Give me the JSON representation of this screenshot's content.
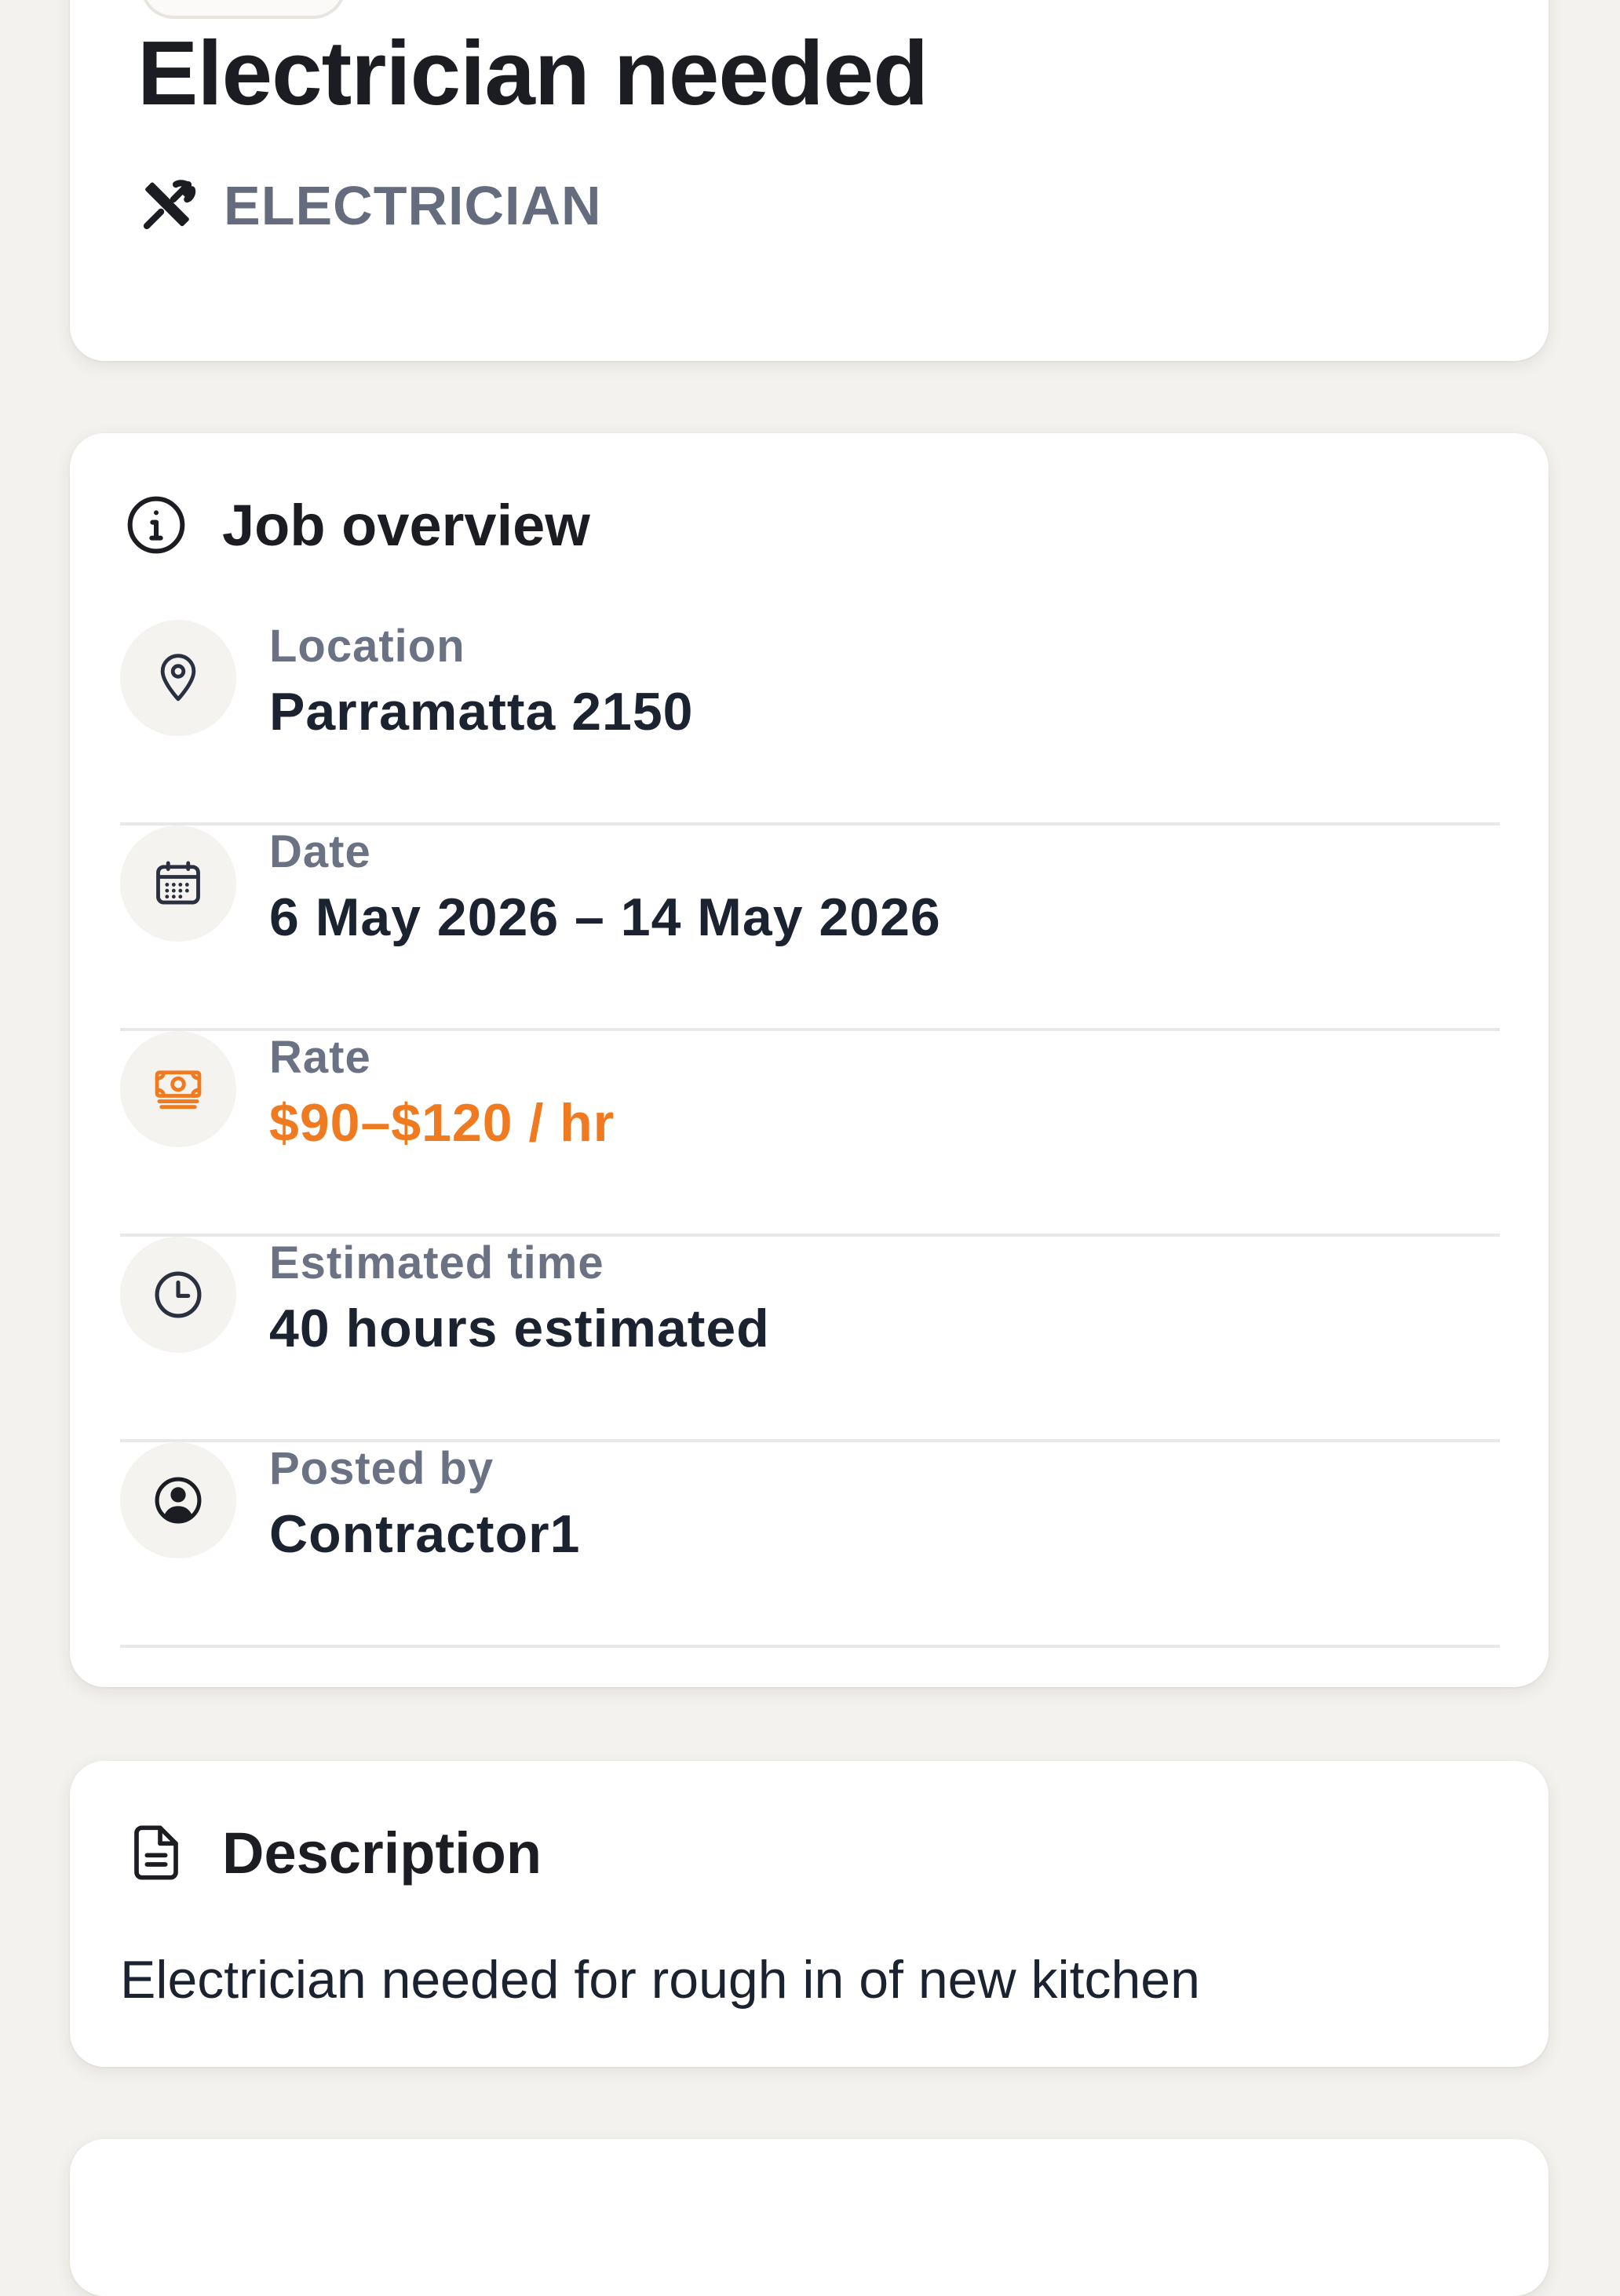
{
  "job": {
    "title": "Electrician needed",
    "trade": "ELECTRICIAN",
    "trade_icon": "tools-icon"
  },
  "overview": {
    "heading": "Job overview",
    "heading_icon": "info-icon",
    "rows": [
      {
        "label": "Location",
        "value": "Parramatta 2150",
        "icon": "map-pin-icon"
      },
      {
        "label": "Date",
        "value": "6 May 2026 – 14 May 2026",
        "icon": "calendar-icon"
      },
      {
        "label": "Rate",
        "value": "$90–$120 / hr",
        "icon": "cash-icon",
        "accent": true
      },
      {
        "label": "Estimated time",
        "value": "40 hours estimated",
        "icon": "clock-icon"
      },
      {
        "label": "Posted by",
        "value": "Contractor1",
        "icon": "user-circle-icon"
      }
    ]
  },
  "description": {
    "heading": "Description",
    "heading_icon": "document-icon",
    "text": "Electrician needed for rough in of new kitchen"
  },
  "colors": {
    "background": "#f4f2ee",
    "card": "#ffffff",
    "accent": "#f07a20",
    "label": "#6a7284",
    "text": "#1b2230"
  }
}
